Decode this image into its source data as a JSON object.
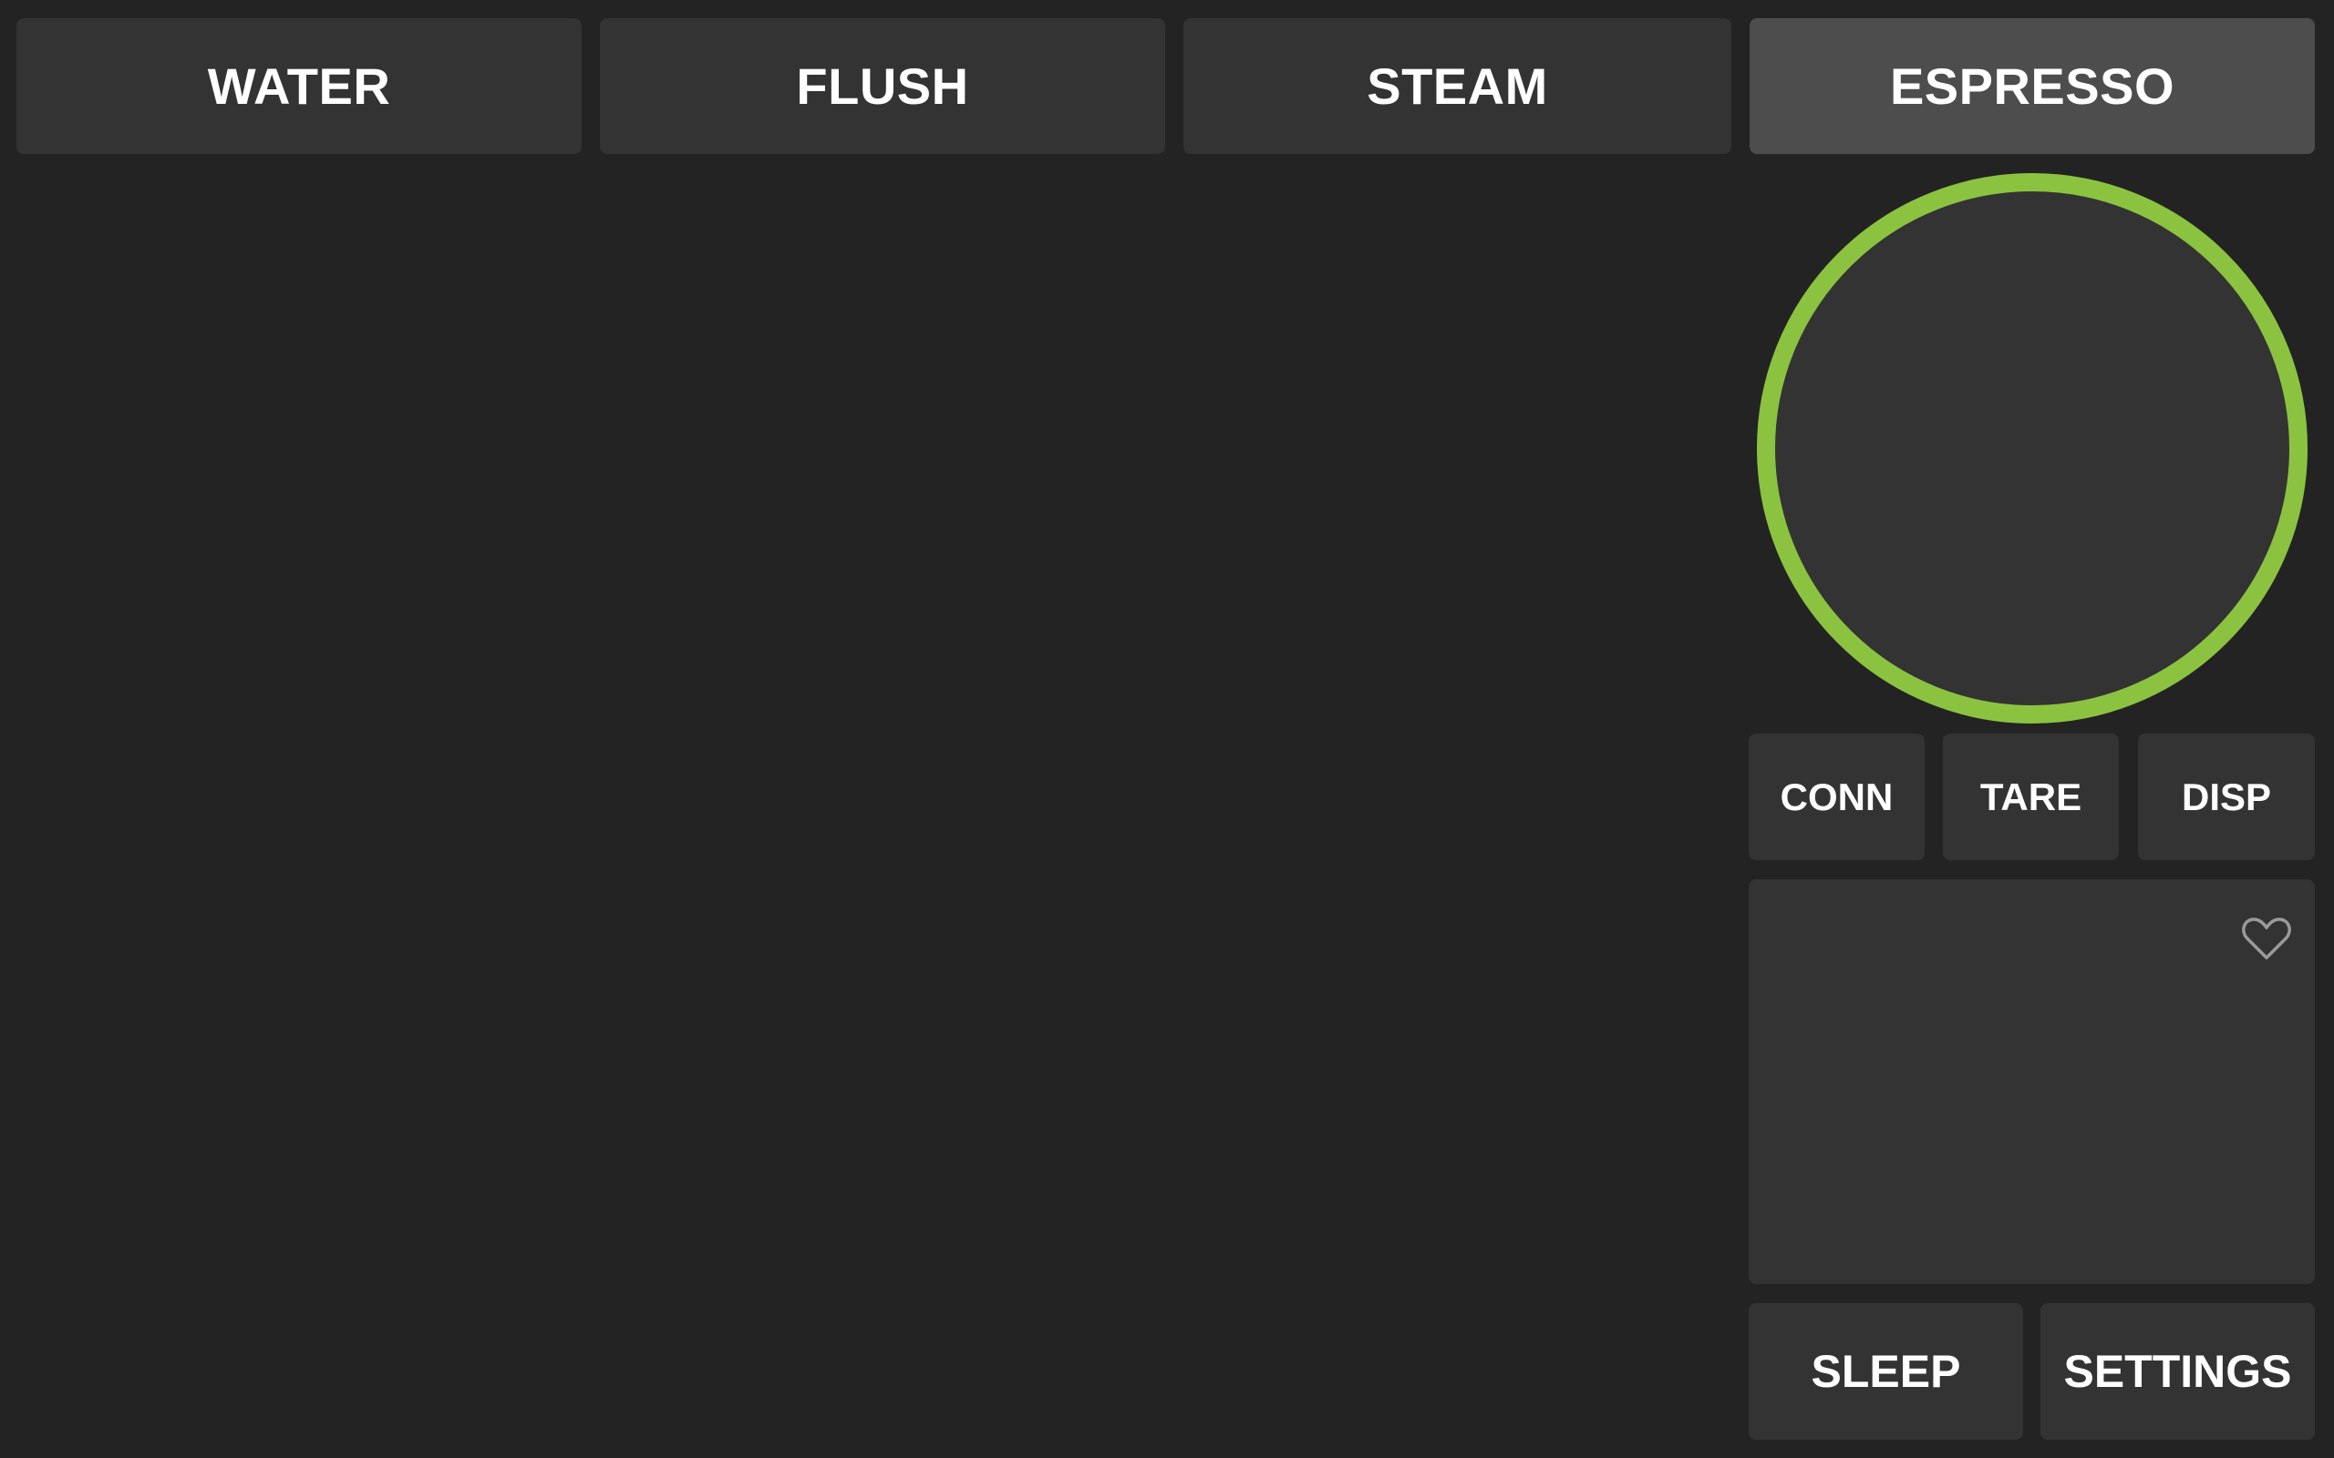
{
  "colors": {
    "background": "#232323",
    "button": "#333333",
    "button_active": "#4d4d4d",
    "dial_ring": "#8bc340",
    "heart_outline": "#9a9a9a"
  },
  "tabs": [
    {
      "label": "WATER",
      "active": false
    },
    {
      "label": "FLUSH",
      "active": false
    },
    {
      "label": "STEAM",
      "active": false
    },
    {
      "label": "ESPRESSO",
      "active": true
    }
  ],
  "scale_buttons": {
    "conn": "CONN",
    "tare": "TARE",
    "disp": "DISP"
  },
  "panel": {
    "favorite_icon": "heart-outline-icon"
  },
  "bottom_buttons": {
    "sleep": "SLEEP",
    "settings": "SETTINGS"
  }
}
